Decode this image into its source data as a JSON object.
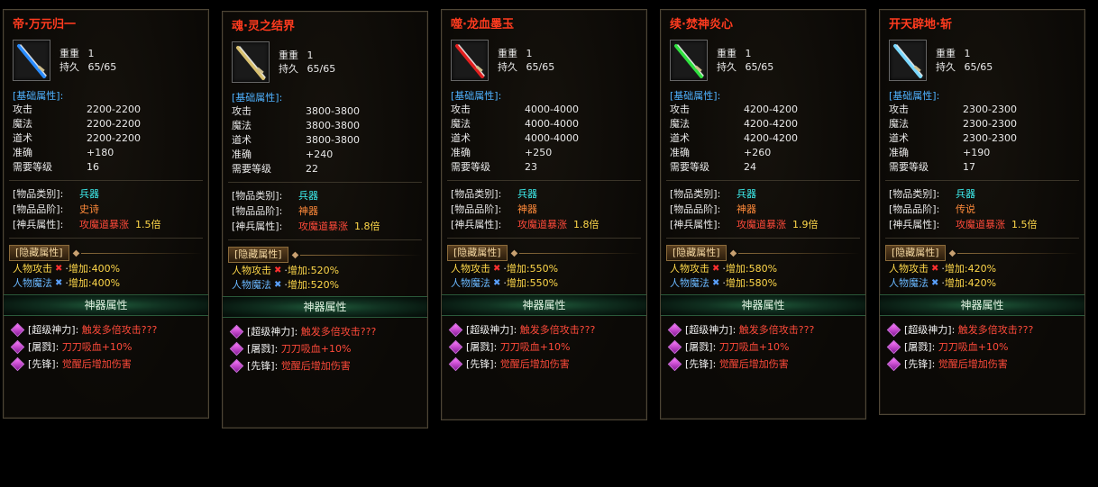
{
  "labels": {
    "weight": "重重",
    "durability": "持久",
    "base_section": "[基础属性]:",
    "attack": "攻击",
    "magic": "魔法",
    "tao": "道术",
    "accuracy": "准确",
    "req_level": "需要等级",
    "item_type": "[物品类别]:",
    "item_grade": "[物品品阶]:",
    "divine_attr": "[神兵属性]:",
    "hidden_section": "[隐藏属性]",
    "char_attack": "人物攻击",
    "char_magic": "人物魔法",
    "x_mark": "✖",
    "bullet": "·",
    "increase": "增加:",
    "artifact_section": "神器属性",
    "skill1": "[超级神力]:",
    "skill1_desc": "触发多倍攻击???",
    "skill2": "[屠戮]:",
    "skill2_desc": "刀刀吸血+10%",
    "skill3": "[先锋]:",
    "skill3_desc": "觉醒后增加伤害"
  },
  "colors": {
    "title": "#ff3b1f",
    "cyan": "#3ef0f0",
    "orange": "#ff8a3a",
    "red": "#ff4a3a",
    "yellow": "#ffd84a"
  },
  "items": [
    {
      "title": "帝·万元归一",
      "weight": "1",
      "durability": "65/65",
      "attack": "2200-2200",
      "magic": "2200-2200",
      "tao": "2200-2200",
      "accuracy": "+180",
      "req_level": "16",
      "item_type": "兵器",
      "item_grade": "史诗",
      "divine_attr": "攻魔道暴涨",
      "divine_mult": "1.5倍",
      "char_attack_inc": "400%",
      "char_magic_inc": "400%",
      "icon": "blue-sword-icon",
      "icon_color": "#2a8cff"
    },
    {
      "title": "魂·灵之结界",
      "weight": "1",
      "durability": "65/65",
      "attack": "3800-3800",
      "magic": "3800-3800",
      "tao": "3800-3800",
      "accuracy": "+240",
      "req_level": "22",
      "item_type": "兵器",
      "item_grade": "神器",
      "divine_attr": "攻魔道暴涨",
      "divine_mult": "1.8倍",
      "char_attack_inc": "520%",
      "char_magic_inc": "520%",
      "icon": "golden-scythe-icon",
      "icon_color": "#d8c070"
    },
    {
      "title": "噬·龙血墨玉",
      "weight": "1",
      "durability": "65/65",
      "attack": "4000-4000",
      "magic": "4000-4000",
      "tao": "4000-4000",
      "accuracy": "+250",
      "req_level": "23",
      "item_type": "兵器",
      "item_grade": "神器",
      "divine_attr": "攻魔道暴涨",
      "divine_mult": "1.8倍",
      "char_attack_inc": "550%",
      "char_magic_inc": "550%",
      "icon": "red-sword-icon",
      "icon_color": "#e02020"
    },
    {
      "title": "续·焚神炎心",
      "weight": "1",
      "durability": "65/65",
      "attack": "4200-4200",
      "magic": "4200-4200",
      "tao": "4200-4200",
      "accuracy": "+260",
      "req_level": "24",
      "item_type": "兵器",
      "item_grade": "神器",
      "divine_attr": "攻魔道暴涨",
      "divine_mult": "1.9倍",
      "char_attack_inc": "580%",
      "char_magic_inc": "580%",
      "icon": "green-sword-icon",
      "icon_color": "#30e040"
    },
    {
      "title": "开天辟地·斩",
      "weight": "1",
      "durability": "65/65",
      "attack": "2300-2300",
      "magic": "2300-2300",
      "tao": "2300-2300",
      "accuracy": "+190",
      "req_level": "17",
      "item_type": "兵器",
      "item_grade": "传说",
      "divine_attr": "攻魔道暴涨",
      "divine_mult": "1.5倍",
      "char_attack_inc": "420%",
      "char_magic_inc": "420%",
      "icon": "cyan-sword-icon",
      "icon_color": "#7ad8ff"
    }
  ]
}
